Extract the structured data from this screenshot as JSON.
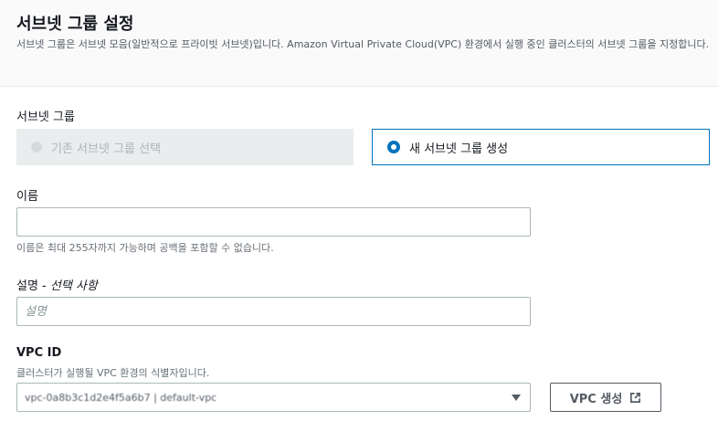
{
  "section": {
    "title": "서브넷 그룹 설정",
    "description": "서브넷 그룹은 서브넷 모음(일반적으로 프라이빗 서브넷)입니다. Amazon Virtual Private Cloud(VPC) 환경에서 실행 중인 클러스터의 서브넷 그룹을 지정합니다."
  },
  "subnet_group": {
    "label": "서브넷 그룹",
    "options": [
      {
        "label": "기존 서브넷 그룹 선택",
        "selected": false,
        "disabled": true
      },
      {
        "label": "새 서브넷 그룹 생성",
        "selected": true,
        "disabled": false
      }
    ]
  },
  "name_field": {
    "label": "이름",
    "value": "",
    "hint": "이름은 최대 255자까지 가능하며 공백을 포함할 수 없습니다."
  },
  "description_field": {
    "label": "설명",
    "optional": " - 선택 사항",
    "placeholder": "설명",
    "value": ""
  },
  "vpc": {
    "label": "VPC ID",
    "hint": "클러스터가 실행될 VPC 환경의 식별자입니다.",
    "selected_value": "vpc-0a8b3c1d2e4f5a6b7 | default-vpc",
    "create_button": "VPC 생성"
  },
  "colors": {
    "accent": "#0073bb",
    "disabled_tile": "#eaeded",
    "header_bg": "#fafafa"
  }
}
